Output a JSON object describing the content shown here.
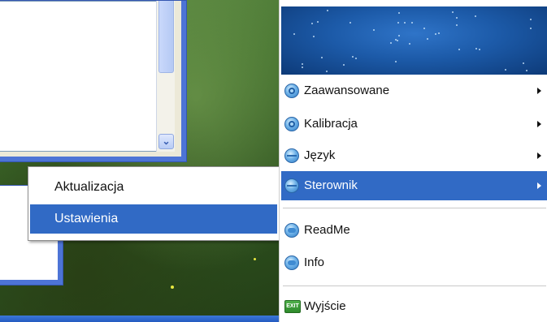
{
  "submenu": {
    "items": [
      {
        "label": "Aktualizacja"
      },
      {
        "label": "Ustawienia"
      }
    ]
  },
  "menu": {
    "items": [
      {
        "label": "Zaawansowane",
        "icon": "gear-icon",
        "has_submenu": true
      },
      {
        "label": "Kalibracja",
        "icon": "gear-icon",
        "has_submenu": true
      },
      {
        "label": "Język",
        "icon": "globe-icon",
        "has_submenu": true
      },
      {
        "label": "Sterownik",
        "icon": "globe-icon",
        "has_submenu": true
      },
      {
        "label": "ReadMe",
        "icon": "chat-icon",
        "has_submenu": false
      },
      {
        "label": "Info",
        "icon": "chat-icon",
        "has_submenu": false
      },
      {
        "label": "Wyjście",
        "icon": "exit-icon",
        "has_submenu": false
      }
    ],
    "exit_icon_text": "EXIT"
  },
  "colors": {
    "highlight": "#316ac5",
    "banner": "#1c5aa8"
  }
}
